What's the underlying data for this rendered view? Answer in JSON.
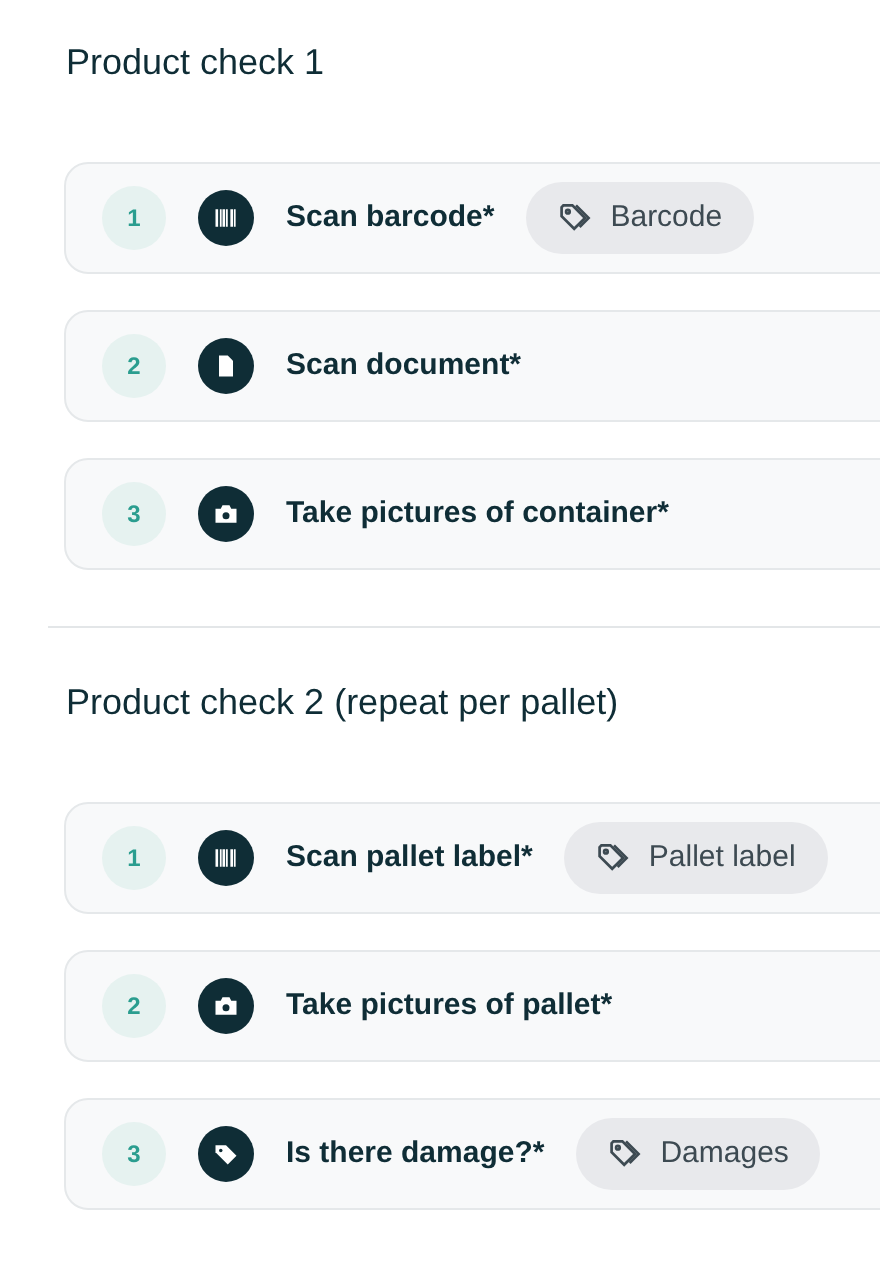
{
  "sections": [
    {
      "title": "Product check 1",
      "steps": [
        {
          "number": "1",
          "kind": "barcode",
          "label": "Scan barcode*",
          "tag": "Barcode"
        },
        {
          "number": "2",
          "kind": "document",
          "label": "Scan document*"
        },
        {
          "number": "3",
          "kind": "camera",
          "label": "Take pictures of container*"
        }
      ]
    },
    {
      "title": "Product check 2 (repeat per pallet)",
      "steps": [
        {
          "number": "1",
          "kind": "barcode",
          "label": "Scan pallet label*",
          "tag": "Pallet label"
        },
        {
          "number": "2",
          "kind": "camera",
          "label": "Take pictures of pallet*"
        },
        {
          "number": "3",
          "kind": "tag",
          "label": "Is there damage?*",
          "tag": "Damages"
        }
      ]
    }
  ]
}
